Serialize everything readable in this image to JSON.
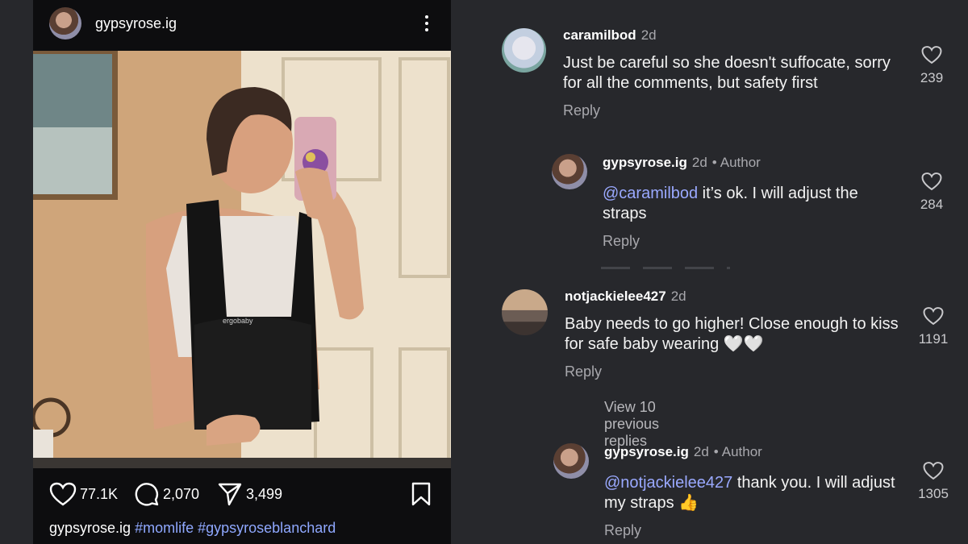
{
  "post": {
    "username": "gypsyrose.ig",
    "likes": "77.1K",
    "comments": "2,070",
    "shares": "3,499",
    "caption_user": "gypsyrose.ig",
    "hashtags": [
      "#momlife",
      "#gypsyroseblanchard"
    ]
  },
  "comments": [
    {
      "username": "caramilbod",
      "age": "2d",
      "text": "Just be careful so she doesn't suffocate, sorry for all the comments, but safety first",
      "reply_label": "Reply",
      "likes": "239"
    },
    {
      "username": "gypsyrose.ig",
      "age": "2d",
      "author_label": "Author",
      "mention": "@caramilbod",
      "text": " it’s ok. I will adjust the straps",
      "reply_label": "Reply",
      "likes": "284"
    },
    {
      "username": "notjackielee427",
      "age": "2d",
      "text": "Baby needs to go higher! Close enough to kiss for safe baby wearing 🤍🤍",
      "reply_label": "Reply",
      "likes": "1191",
      "view_replies": "View 10 previous replies"
    },
    {
      "username": "gypsyrose.ig",
      "age": "2d",
      "author_label": "Author",
      "mention": "@notjackielee427",
      "text": " thank you. I will adjust my straps 👍",
      "reply_label": "Reply",
      "likes": "1305"
    }
  ],
  "colors": {
    "panel_bg": "#27282c",
    "post_bg": "#0d0d0f",
    "mention": "#9aa9ff",
    "hashtag": "#8fa8ff",
    "secondary_text": "#a8a8ad"
  }
}
